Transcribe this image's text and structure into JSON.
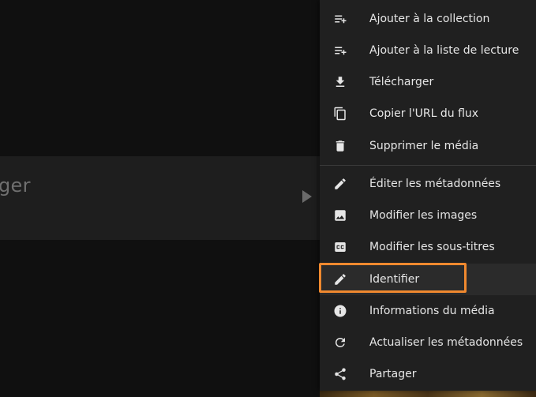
{
  "background": {
    "partial_title": "ger"
  },
  "menu": {
    "items": [
      {
        "label": "Ajouter à la collection",
        "icon": "playlist-add-icon"
      },
      {
        "label": "Ajouter à la liste de lecture",
        "icon": "playlist-add-icon"
      },
      {
        "label": "Télécharger",
        "icon": "download-icon"
      },
      {
        "label": "Copier l'URL du flux",
        "icon": "copy-icon"
      },
      {
        "label": "Supprimer le média",
        "icon": "delete-icon"
      },
      {
        "label": "Éditer les métadonnées",
        "icon": "edit-icon"
      },
      {
        "label": "Modifier les images",
        "icon": "image-icon"
      },
      {
        "label": "Modifier les sous-titres",
        "icon": "closed-caption-icon"
      },
      {
        "label": "Identifier",
        "icon": "edit-icon"
      },
      {
        "label": "Informations du média",
        "icon": "info-icon"
      },
      {
        "label": "Actualiser les métadonnées",
        "icon": "refresh-icon"
      },
      {
        "label": "Partager",
        "icon": "share-icon"
      }
    ],
    "highlighted_item": "Identifier",
    "highlight_color": "#f0892f"
  }
}
